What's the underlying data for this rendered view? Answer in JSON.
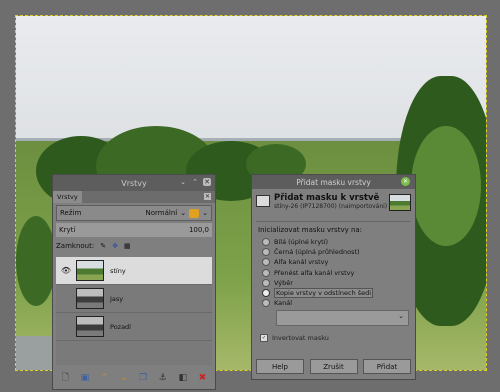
{
  "layers_panel": {
    "title": "Vrstvy",
    "tab_label": "Vrstvy",
    "mode_label": "Režim",
    "mode_value": "Normální",
    "opacity_label": "Krytí",
    "opacity_value": "100,0",
    "lock_label": "Zamknout:",
    "layers": [
      {
        "name": "stíny",
        "selected": true,
        "visible": true
      },
      {
        "name": "Jasy",
        "selected": false,
        "visible": false
      },
      {
        "name": "Pozadí",
        "selected": false,
        "visible": false
      }
    ]
  },
  "mask_dialog": {
    "window_title": "Přidat masku vrstvy",
    "heading": "Přidat masku k vrstvě",
    "subheading": "stíny-26 (IP7128700) (naimportováni)",
    "section_label": "Inicializovat masku vrstvy na:",
    "options": [
      "Bílá (úplné krytí)",
      "Černá (úplná průhlednost)",
      "Alfa kanál vrstvy",
      "Přenést alfa kanál vrstvy",
      "Výběr",
      "Kopie vrstvy v odstínech šedi",
      "Kanál"
    ],
    "selected_option_index": 5,
    "invert_label": "Invertovat masku",
    "invert_checked": true,
    "help_label": "Help",
    "cancel_label": "Zrušit",
    "add_label": "Přidat"
  },
  "colors": {
    "canvas_bg": "#6e6e6e",
    "selection_border": "#e0d020",
    "dialog_close": "#7ac04a"
  }
}
